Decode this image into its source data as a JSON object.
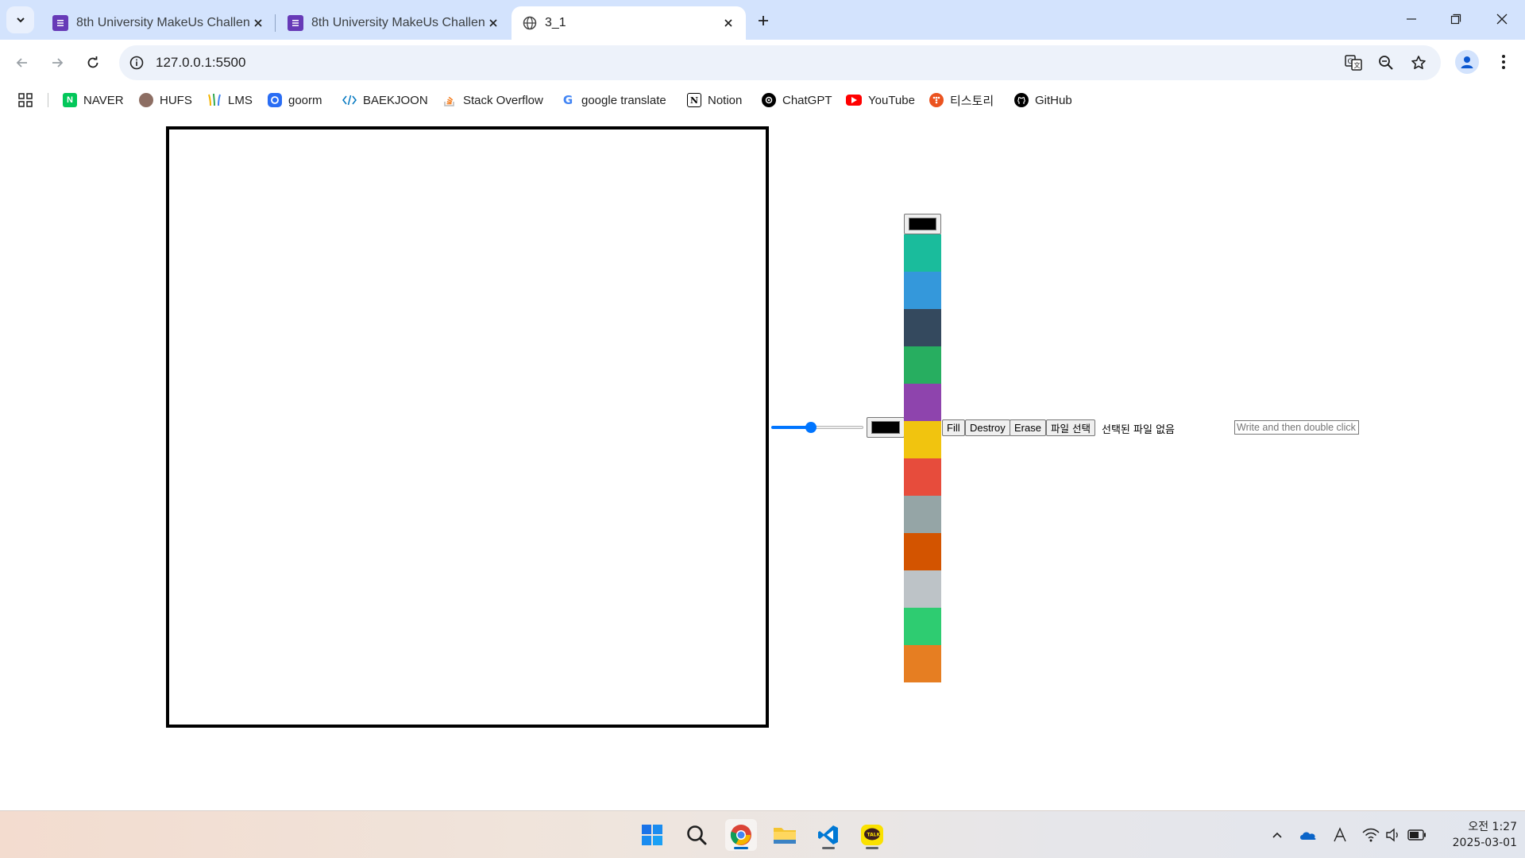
{
  "browser": {
    "tabs": [
      {
        "title": "8th University MakeUs Challen",
        "active": false,
        "icon": "google-forms-icon"
      },
      {
        "title": "8th University MakeUs Challen",
        "active": false,
        "icon": "google-forms-icon"
      },
      {
        "title": "3_1",
        "active": true,
        "icon": "globe-icon"
      }
    ],
    "url": "127.0.0.1:5500",
    "bookmarks": [
      {
        "label": "NAVER",
        "icon": "naver-icon",
        "color": "#03c75a"
      },
      {
        "label": "HUFS",
        "icon": "hufs-icon",
        "color": "#8d6e63"
      },
      {
        "label": "LMS",
        "icon": "lms-icon",
        "color": "#f4b400"
      },
      {
        "label": "goorm",
        "icon": "goorm-icon",
        "color": "#2a6df4"
      },
      {
        "label": "BAEKJOON",
        "icon": "baekjoon-icon",
        "color": "#0076c0"
      },
      {
        "label": "Stack Overflow",
        "icon": "stackoverflow-icon",
        "color": "#f48024"
      },
      {
        "label": "google translate",
        "icon": "google-icon",
        "color": "#4285f4"
      },
      {
        "label": "Notion",
        "icon": "notion-icon",
        "color": "#000000"
      },
      {
        "label": "ChatGPT",
        "icon": "chatgpt-icon",
        "color": "#000000"
      },
      {
        "label": "YouTube",
        "icon": "youtube-icon",
        "color": "#ff0000"
      },
      {
        "label": "티스토리",
        "icon": "tistory-icon",
        "color": "#eb531f"
      },
      {
        "label": "GitHub",
        "icon": "github-icon",
        "color": "#000000"
      }
    ]
  },
  "app": {
    "line_width_value": 5,
    "line_width_min": 1,
    "line_width_max": 10,
    "current_color": "#000000",
    "palette_current_color": "#000000",
    "palette": [
      "#1abc9c",
      "#3498db",
      "#34495e",
      "#27ae60",
      "#8e44ad",
      "#f1c40f",
      "#e74c3c",
      "#95a5a6",
      "#d35400",
      "#bdc3c7",
      "#2ecc71",
      "#e67e22"
    ],
    "buttons": {
      "fill": "Fill",
      "destroy": "Destroy",
      "erase": "Erase",
      "file_choose": "파일 선택"
    },
    "file_status": "선택된 파일 없음",
    "text_placeholder": "Write and then double click"
  },
  "taskbar": {
    "apps": [
      "windows-start-icon",
      "search-icon",
      "chrome-icon",
      "file-explorer-icon",
      "vscode-icon",
      "kakaotalk-icon"
    ],
    "time": "오전 1:27",
    "date": "2025-03-01"
  }
}
